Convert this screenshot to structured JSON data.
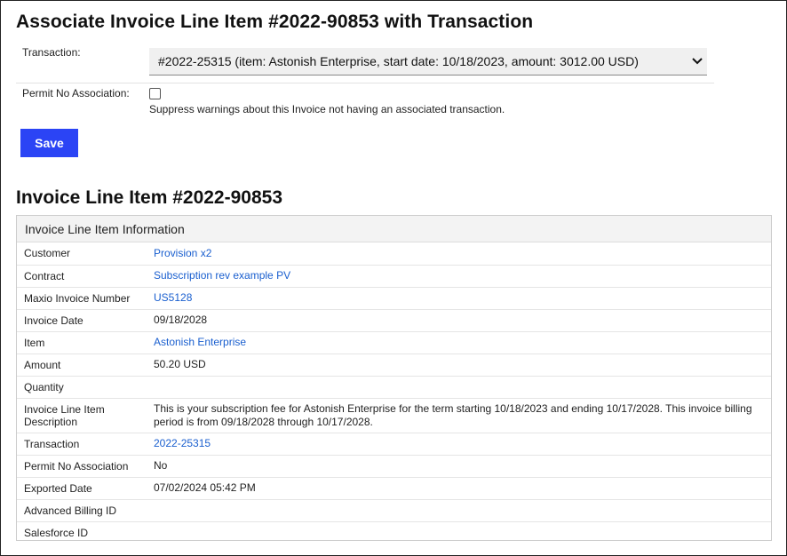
{
  "page_title": "Associate Invoice Line Item #2022-90853 with Transaction",
  "form": {
    "transaction_label": "Transaction:",
    "transaction_value": "#2022-25315 (item: Astonish Enterprise, start date: 10/18/2023, amount: 3012.00 USD)",
    "permit_label": "Permit No Association:",
    "permit_checked": false,
    "permit_help": "Suppress warnings about this Invoice not having an associated transaction.",
    "save_label": "Save"
  },
  "detail_title": "Invoice Line Item #2022-90853",
  "panel": {
    "heading": "Invoice Line Item Information",
    "rows": [
      {
        "key": "Customer",
        "value": "Provision x2",
        "link": true
      },
      {
        "key": "Contract",
        "value": "Subscription rev example PV",
        "link": true
      },
      {
        "key": "Maxio Invoice Number",
        "value": "US5128",
        "link": true
      },
      {
        "key": "Invoice Date",
        "value": "09/18/2028",
        "link": false
      },
      {
        "key": "Item",
        "value": "Astonish Enterprise",
        "link": true
      },
      {
        "key": "Amount",
        "value": "50.20 USD",
        "link": false
      },
      {
        "key": "Quantity",
        "value": "",
        "link": false
      },
      {
        "key": "Invoice Line Item Description",
        "value": "This is your subscription fee for Astonish Enterprise for the term starting 10/18/2023 and ending 10/17/2028. This invoice billing period is from 09/18/2028 through 10/17/2028.",
        "link": false
      },
      {
        "key": "Transaction",
        "value": "2022-25315",
        "link": true
      },
      {
        "key": "Permit No Association",
        "value": "No",
        "link": false
      },
      {
        "key": "Exported Date",
        "value": "07/02/2024 05:42 PM",
        "link": false
      },
      {
        "key": "Advanced Billing ID",
        "value": "",
        "link": false
      },
      {
        "key": "Salesforce ID",
        "value": "",
        "link": false
      }
    ]
  },
  "colors": {
    "accent": "#2b44f5",
    "link": "#1a5fcf"
  },
  "icons": {
    "select": "chevron-down-icon"
  }
}
